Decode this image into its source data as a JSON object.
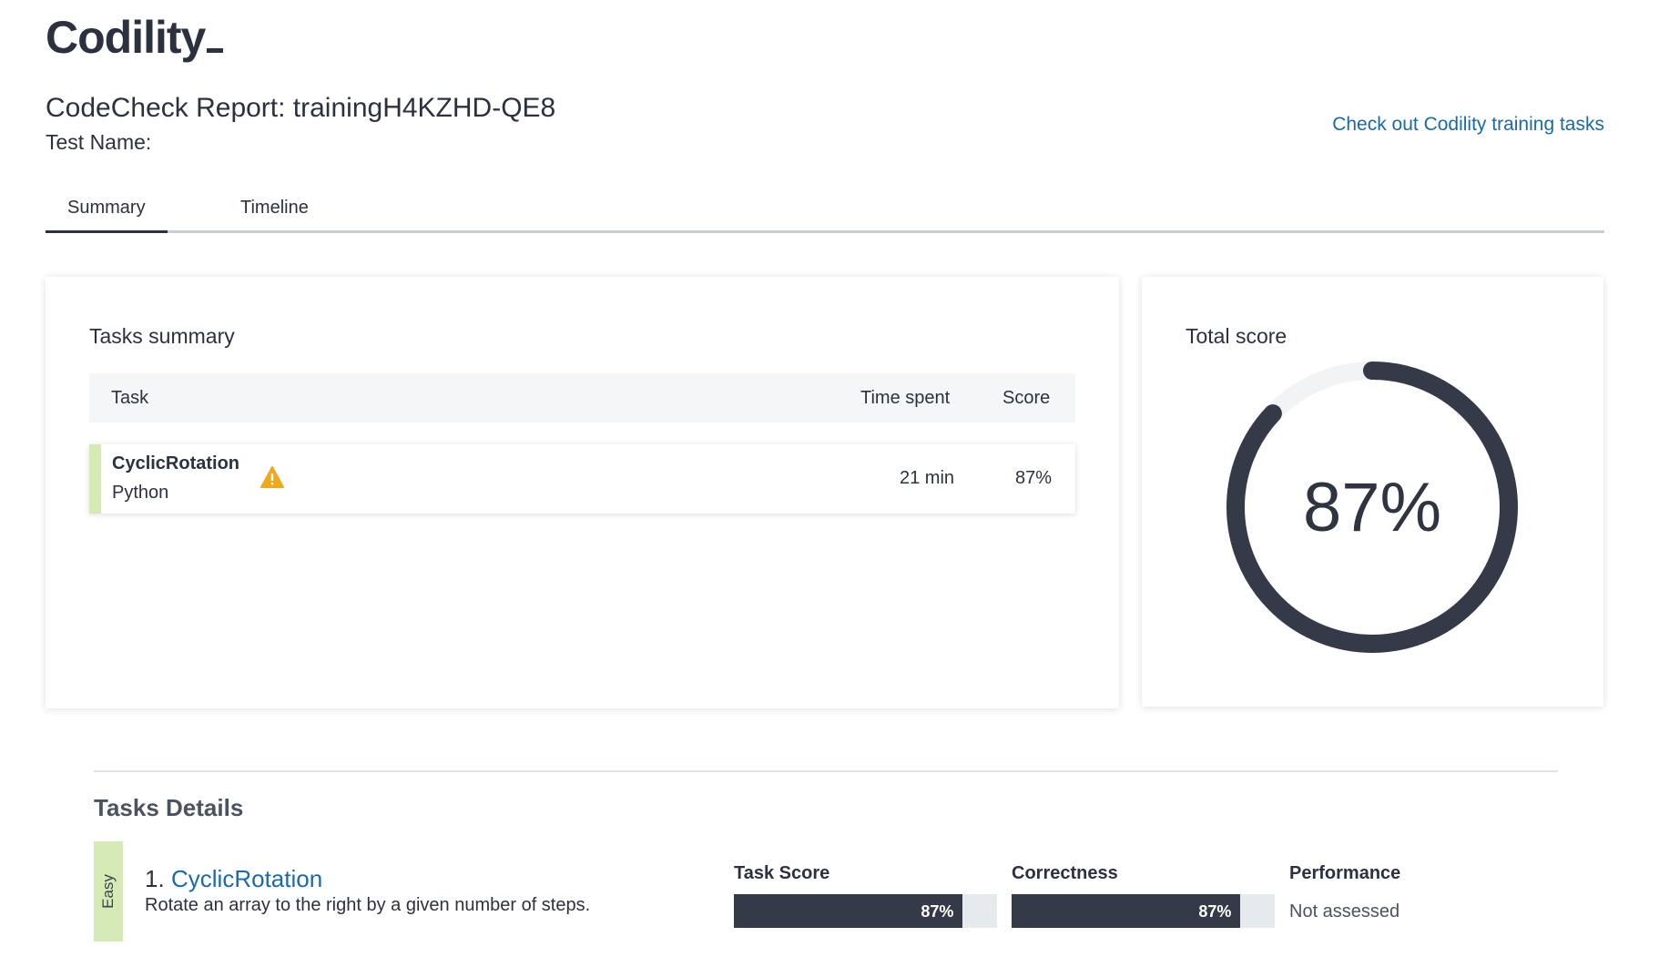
{
  "logo": {
    "text": "Codility"
  },
  "header": {
    "report_title": "CodeCheck Report: trainingH4KZHD-QE8",
    "test_name_label": "Test Name:",
    "training_link": "Check out Codility training tasks"
  },
  "tabs": [
    {
      "label": "Summary",
      "active": true
    },
    {
      "label": "Timeline",
      "active": false
    }
  ],
  "tasks_summary": {
    "heading": "Tasks summary",
    "columns": [
      "Task",
      "Time spent",
      "Score"
    ],
    "rows": [
      {
        "name": "CyclicRotation",
        "language": "Python",
        "warning_icon": "warning-triangle-icon",
        "time_spent": "21 min",
        "score": "87%"
      }
    ]
  },
  "total_score": {
    "heading": "Total score",
    "value_label": "87%",
    "fraction": 0.87,
    "colors": {
      "fill": "#353a48",
      "track": "#f2f3f5"
    }
  },
  "tasks_details": {
    "heading": "Tasks Details",
    "items": [
      {
        "difficulty": "Easy",
        "number": "1.",
        "name": "CyclicRotation",
        "description": "Rotate an array to the right by a given number of steps.",
        "task_score_label": "Task Score",
        "task_score": "87%",
        "task_score_fraction": 0.87,
        "correctness_label": "Correctness",
        "correctness": "87%",
        "correctness_fraction": 0.87,
        "performance_label": "Performance",
        "performance": "Not assessed"
      }
    ]
  },
  "colors": {
    "link": "#1a6aa6",
    "easy_badge": "#d5eab4",
    "warning": "#f0a81c",
    "bar_fill": "#353a48"
  }
}
